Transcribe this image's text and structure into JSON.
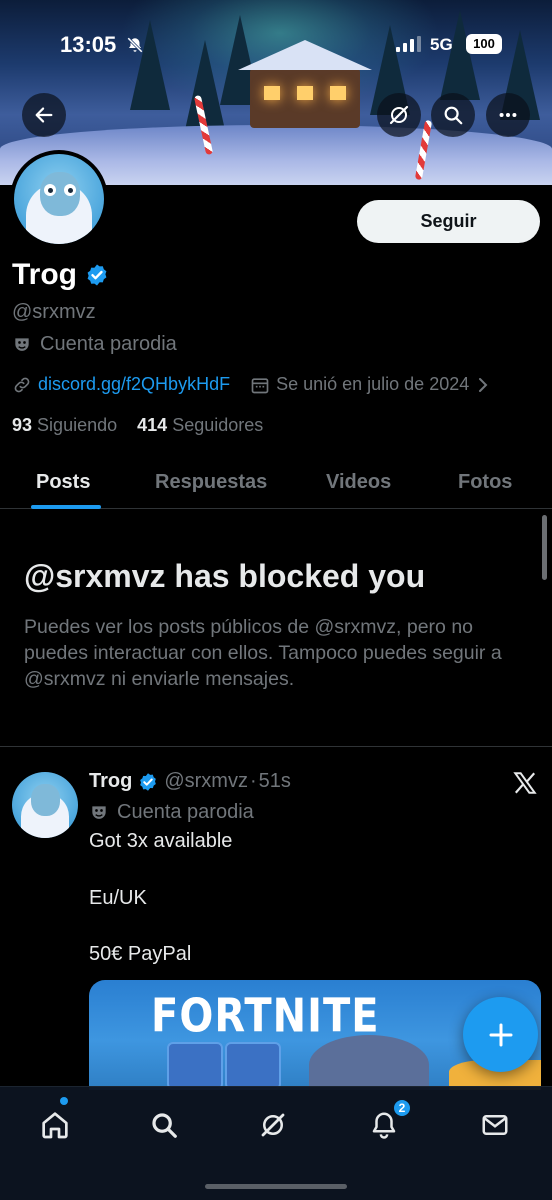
{
  "status_bar": {
    "time": "13:05",
    "network": "5G",
    "battery": "100",
    "icons": [
      "bell-slash-icon",
      "signal-icon"
    ]
  },
  "header": {
    "back_icon": "arrow-left-icon",
    "grok_icon": "grok-icon",
    "search_icon": "search-icon",
    "more_icon": "more-icon"
  },
  "profile": {
    "follow_label": "Seguir",
    "name": "Trog",
    "verified": true,
    "handle": "@srxmvz",
    "parody_label": "Cuenta parodia",
    "link": "discord.gg/f2QHbykHdF",
    "joined": "Se unió en julio de 2024",
    "following_count": "93",
    "following_label": "Siguiendo",
    "followers_count": "414",
    "followers_label": "Seguidores"
  },
  "tabs": [
    {
      "label": "Posts",
      "active": true
    },
    {
      "label": "Respuestas",
      "active": false
    },
    {
      "label": "Videos",
      "active": false
    },
    {
      "label": "Fotos",
      "active": false
    }
  ],
  "blocked": {
    "title": "@srxmvz has blocked you",
    "body": "Puedes ver los posts públicos de @srxmvz, pero no puedes interactuar con ellos. Tampoco puedes seguir a @srxmvz ni enviarle mensajes."
  },
  "post": {
    "name": "Trog",
    "handle": "@srxmvz",
    "sep": "·",
    "time": "51s",
    "parody_label": "Cuenta parodia",
    "lines": [
      "Got 3x available",
      "Eu/UK",
      "50€ PayPal"
    ],
    "media_title": "FORTNITE"
  },
  "fab_icon": "plus-icon",
  "bottom_nav": {
    "items": [
      "home-icon",
      "search-icon",
      "grok-icon",
      "notifications-icon",
      "messages-icon"
    ],
    "notification_badge": "2"
  },
  "colors": {
    "accent": "#1d9bf0",
    "background": "#000000",
    "text_primary": "#e7e9ea",
    "text_secondary": "#71767b"
  }
}
